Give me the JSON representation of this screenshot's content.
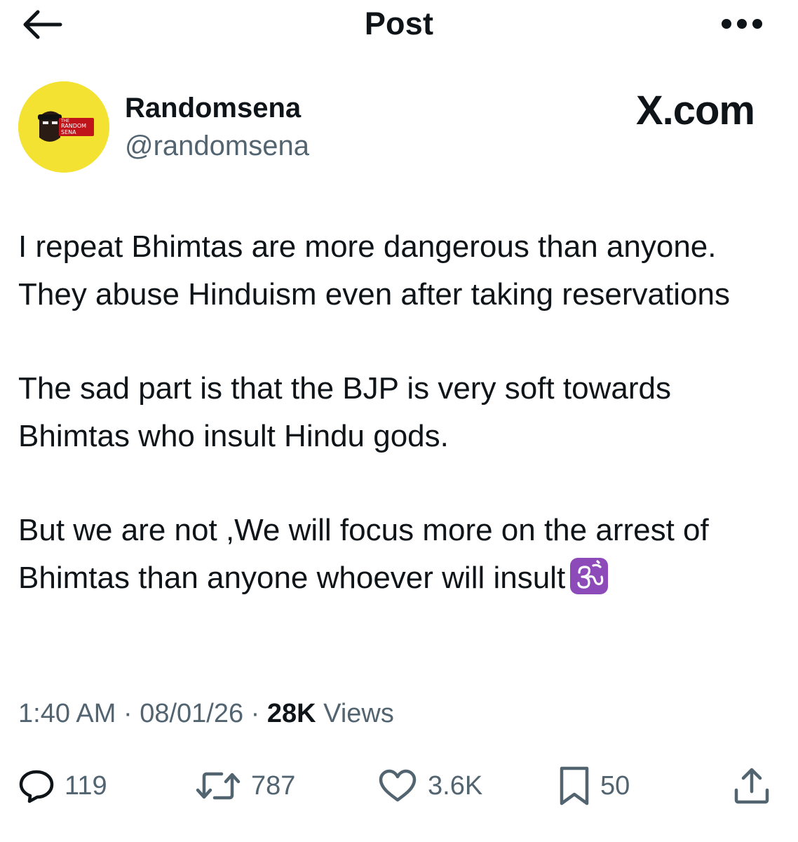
{
  "header": {
    "title": "Post",
    "back_icon": "arrow-left-icon",
    "more_icon": "more-dots-icon"
  },
  "author": {
    "name": "Randomsena",
    "handle": "@randomsena",
    "avatar_bg": "#f4e233"
  },
  "watermark": "X.com",
  "post": {
    "paragraphs": [
      "I repeat Bhimtas are more dangerous than anyone. They abuse Hinduism even after taking reservations",
      "The sad part is that the BJP is very soft towards Bhimtas who insult Hindu gods.",
      "But we are not ,We will focus more on the arrest of Bhimtas than anyone whoever will insult"
    ],
    "emoji": "🕉️"
  },
  "meta": {
    "time": "1:40 AM",
    "sep1": " · ",
    "date": "08/01/26",
    "sep2": " · ",
    "views_count": "28K",
    "views_label": " Views"
  },
  "actions": {
    "reply": "119",
    "repost": "787",
    "like": "3.6K",
    "bookmark": "50"
  },
  "colors": {
    "text": "#0f1419",
    "secondary": "#536471",
    "om_purple": "#8c4bb8"
  }
}
